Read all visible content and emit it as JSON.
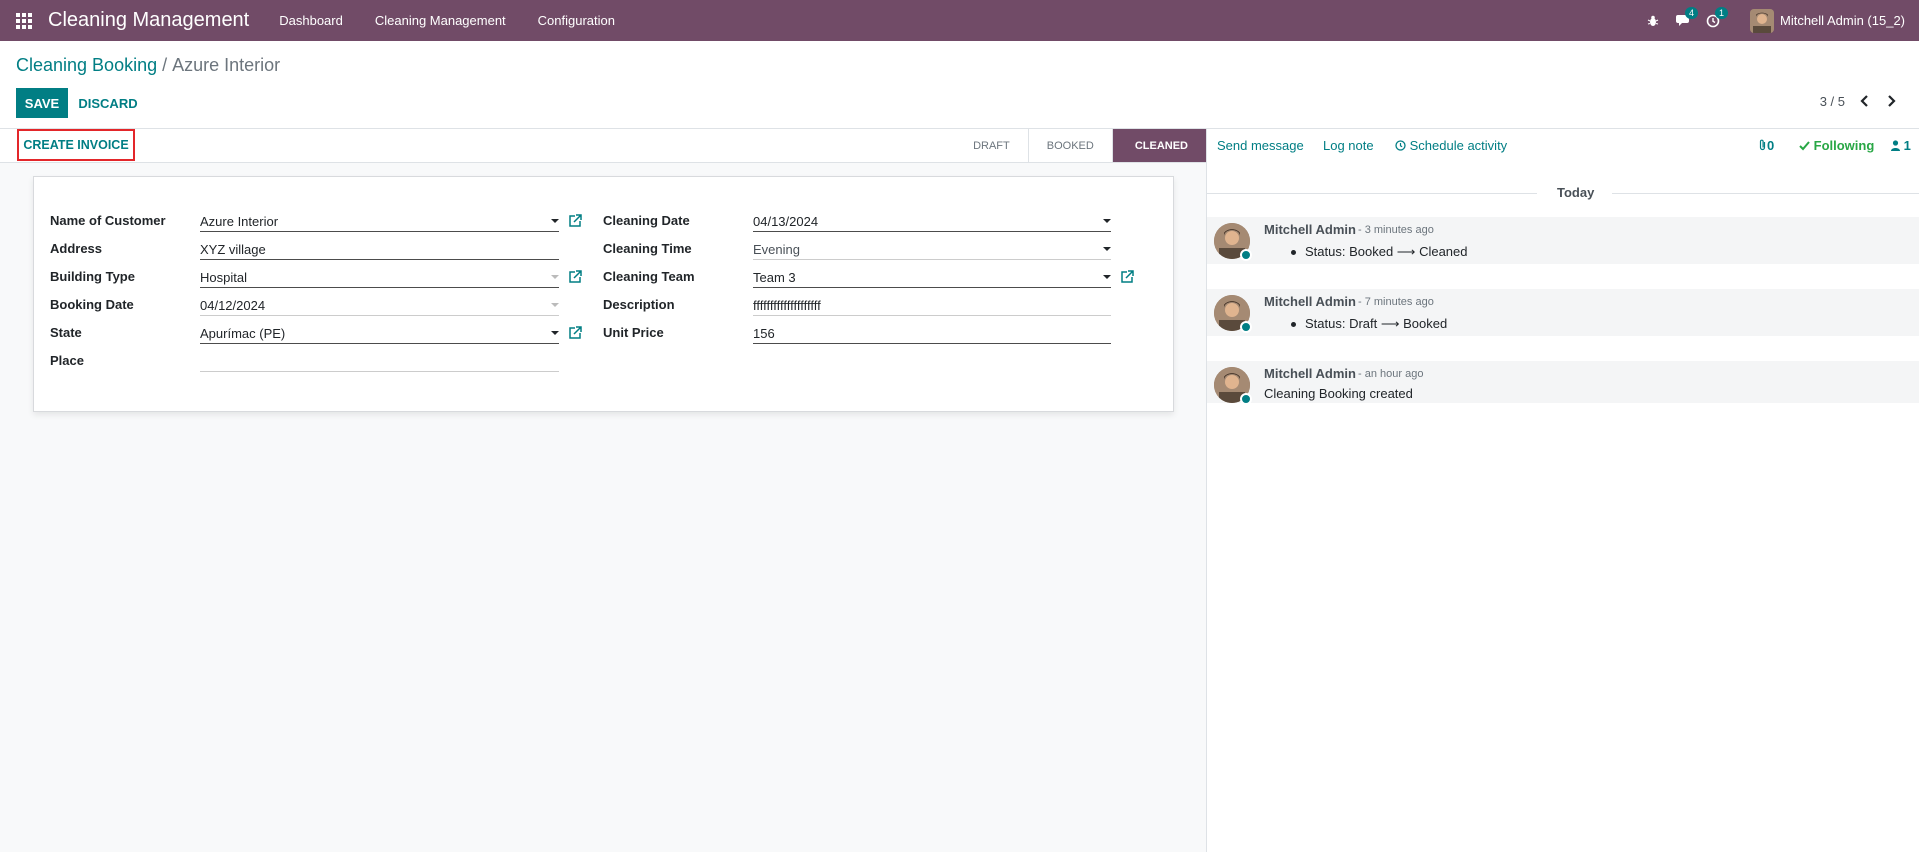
{
  "navbar": {
    "app_title": "Cleaning Management",
    "menu": [
      "Dashboard",
      "Cleaning Management",
      "Configuration"
    ],
    "messages_badge": "4",
    "activities_badge": "1",
    "user_name": "Mitchell Admin (15_2)"
  },
  "breadcrumb": {
    "parent": "Cleaning Booking",
    "separator": "/",
    "current": "Azure Interior"
  },
  "actions": {
    "save_label": "SAVE",
    "discard_label": "DISCARD"
  },
  "pager": {
    "value": "3 / 5"
  },
  "statusbar": {
    "create_invoice_label": "CREATE INVOICE",
    "stages": [
      "DRAFT",
      "BOOKED",
      "CLEANED"
    ],
    "active_stage": "CLEANED"
  },
  "form": {
    "left": [
      {
        "label": "Name of Customer",
        "value": "Azure Interior"
      },
      {
        "label": "Address",
        "value": "XYZ village"
      },
      {
        "label": "Building Type",
        "value": "Hospital"
      },
      {
        "label": "Booking Date",
        "value": "04/12/2024"
      },
      {
        "label": "State",
        "value": "Apurímac (PE)"
      },
      {
        "label": "Place",
        "value": ""
      }
    ],
    "right": [
      {
        "label": "Cleaning Date",
        "value": "04/13/2024"
      },
      {
        "label": "Cleaning Time",
        "value": "Evening"
      },
      {
        "label": "Cleaning Team",
        "value": "Team 3"
      },
      {
        "label": "Description",
        "value": "ffffffffffffffffffff"
      },
      {
        "label": "Unit Price",
        "value": "156"
      }
    ]
  },
  "chatter": {
    "send_message": "Send message",
    "log_note": "Log note",
    "schedule_activity": "Schedule activity",
    "attachments_count": "0",
    "following_label": "Following",
    "followers_count": "1",
    "today_label": "Today",
    "messages": [
      {
        "author": "Mitchell Admin",
        "date": "- 3 minutes ago",
        "status_from": "Status: Booked",
        "arrow": "⟶",
        "status_to": "Cleaned"
      },
      {
        "author": "Mitchell Admin",
        "date": "- 7 minutes ago",
        "status_from": "Status: Draft",
        "arrow": "⟶",
        "status_to": "Booked"
      },
      {
        "author": "Mitchell Admin",
        "date": "- an hour ago",
        "body": "Cleaning Booking created"
      }
    ]
  },
  "colors": {
    "brand": "#714b67",
    "accent": "#017e84",
    "highlight_border": "#e3262a",
    "following": "#28a745"
  }
}
